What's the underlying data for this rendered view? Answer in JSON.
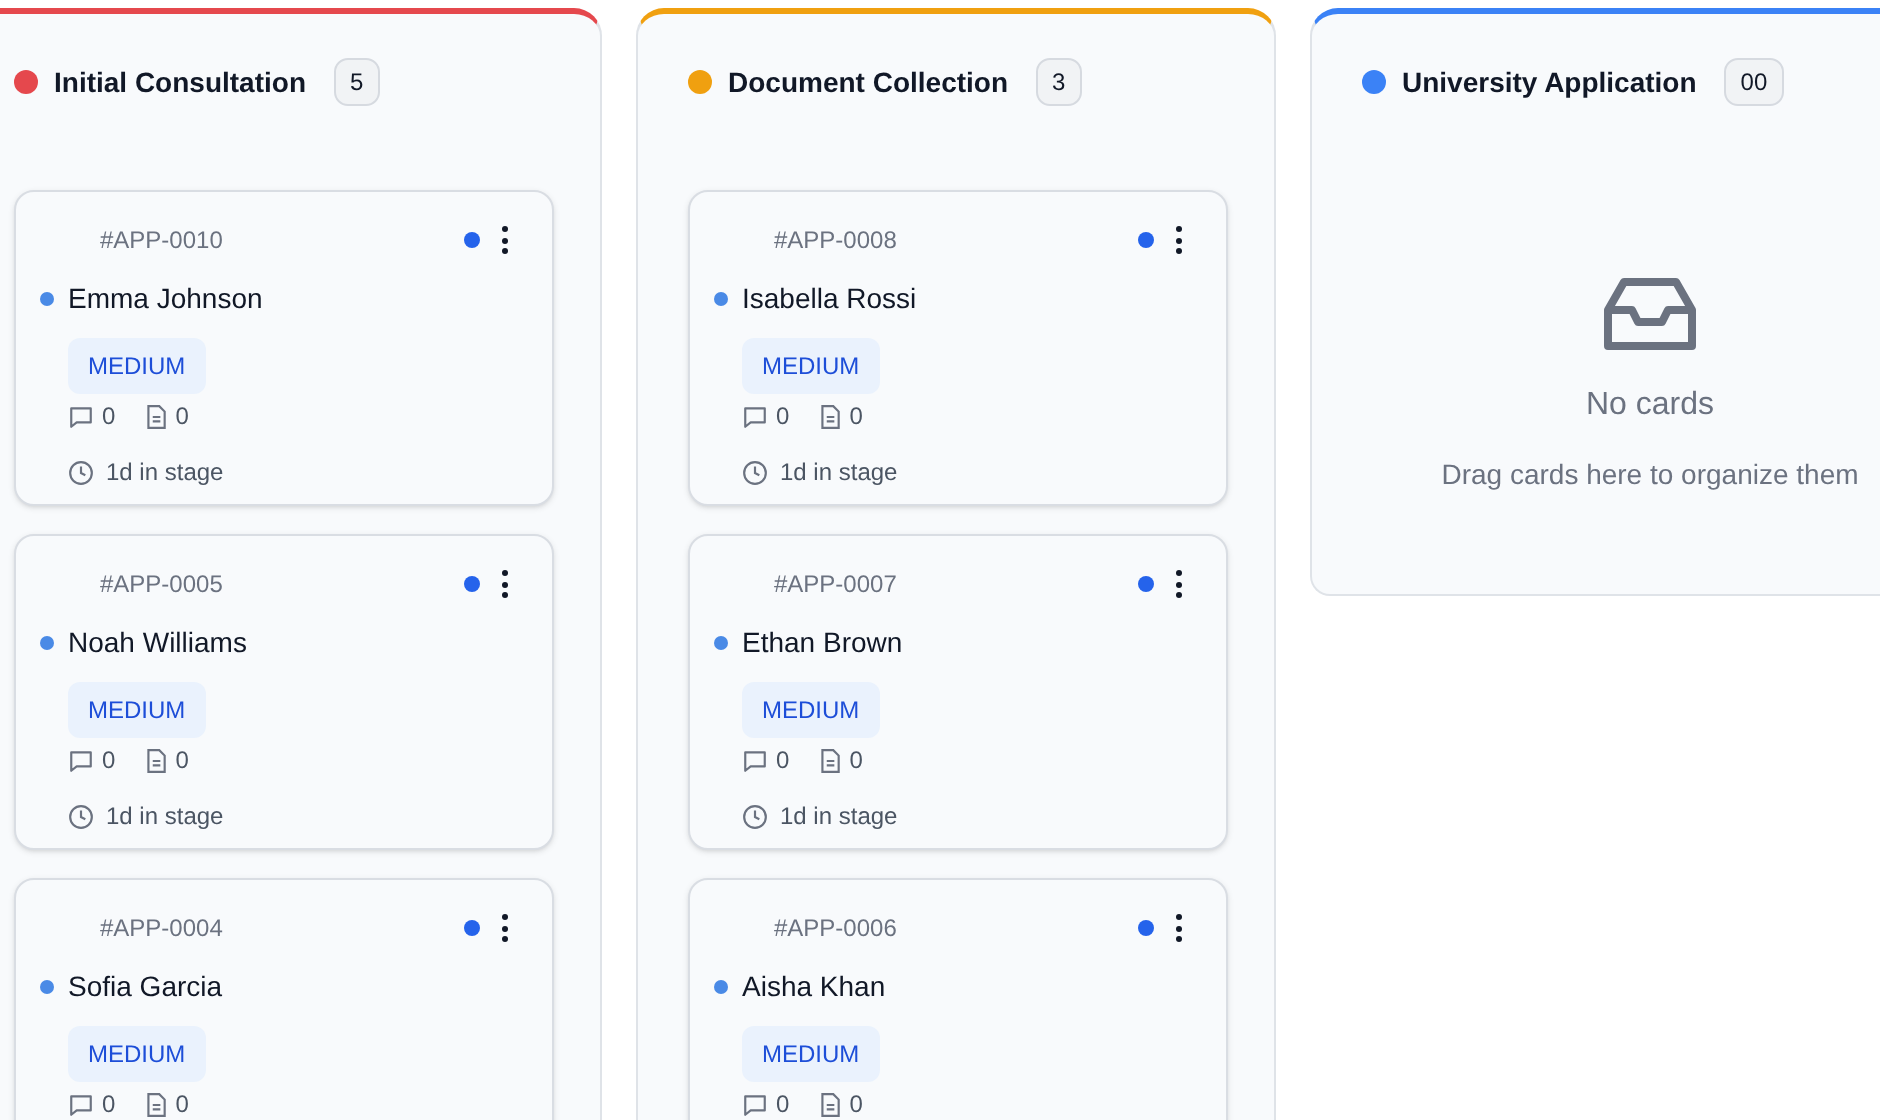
{
  "columns": [
    {
      "title": "Initial Consultation",
      "count": "5",
      "color": "#e5484d",
      "cards": [
        {
          "id": "#APP-0010",
          "name": "Emma Johnson",
          "priority": "MEDIUM",
          "comments": "0",
          "files": "0",
          "time": "1d in stage"
        },
        {
          "id": "#APP-0005",
          "name": "Noah Williams",
          "priority": "MEDIUM",
          "comments": "0",
          "files": "0",
          "time": "1d in stage"
        },
        {
          "id": "#APP-0004",
          "name": "Sofia Garcia",
          "priority": "MEDIUM",
          "comments": "0",
          "files": "0"
        }
      ]
    },
    {
      "title": "Document Collection",
      "count": "3",
      "color": "#f0a010",
      "cards": [
        {
          "id": "#APP-0008",
          "name": "Isabella Rossi",
          "priority": "MEDIUM",
          "comments": "0",
          "files": "0",
          "time": "1d in stage"
        },
        {
          "id": "#APP-0007",
          "name": "Ethan Brown",
          "priority": "MEDIUM",
          "comments": "0",
          "files": "0",
          "time": "1d in stage"
        },
        {
          "id": "#APP-0006",
          "name": "Aisha Khan",
          "priority": "MEDIUM",
          "comments": "0",
          "files": "0"
        }
      ]
    },
    {
      "title": "University Application",
      "count": "00",
      "color": "#3b82f6",
      "empty": {
        "title": "No cards",
        "text": "Drag cards here to organize them"
      }
    }
  ]
}
